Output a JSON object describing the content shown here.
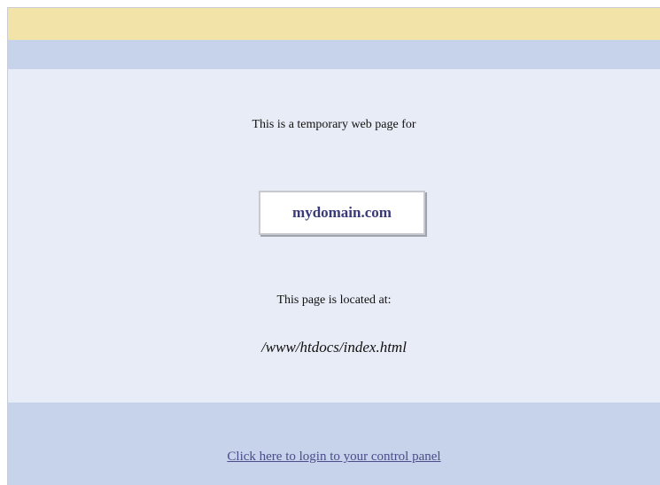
{
  "page": {
    "intro": "This is a temporary web page for",
    "domain": "mydomain.com",
    "located_label": "This page is located at:",
    "path": "/www/htdocs/index.html"
  },
  "footer": {
    "login_link": "Click here to login to your control panel"
  },
  "colors": {
    "top_bar": "#f2e3a9",
    "band": "#c6d3ea",
    "content_bg": "#e8ecf6",
    "domain_text": "#3a3a78",
    "link": "#4c4c8a"
  }
}
